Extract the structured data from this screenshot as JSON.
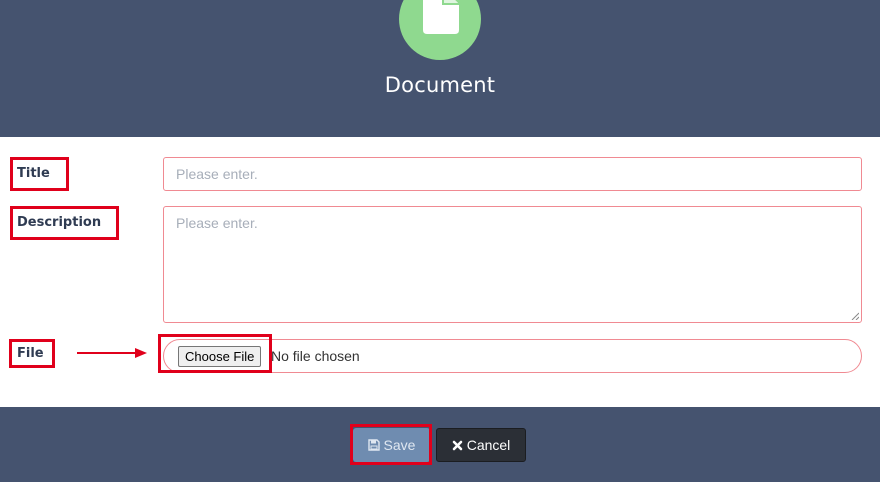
{
  "header": {
    "title": "Document",
    "icon": "document-icon",
    "badge_color": "#8fd98f",
    "background": "#45536f"
  },
  "form": {
    "title": {
      "label": "Title",
      "placeholder": "Please enter."
    },
    "description": {
      "label": "Description",
      "placeholder": "Please enter."
    },
    "file": {
      "label": "File",
      "button_label": "Choose File",
      "status_text": "No file chosen"
    }
  },
  "footer": {
    "save_label": "Save",
    "save_icon": "floppy-disk-icon",
    "cancel_label": "Cancel",
    "cancel_icon": "close-icon"
  },
  "colors": {
    "highlight": "#e0001b",
    "input_border": "#f08a92"
  }
}
